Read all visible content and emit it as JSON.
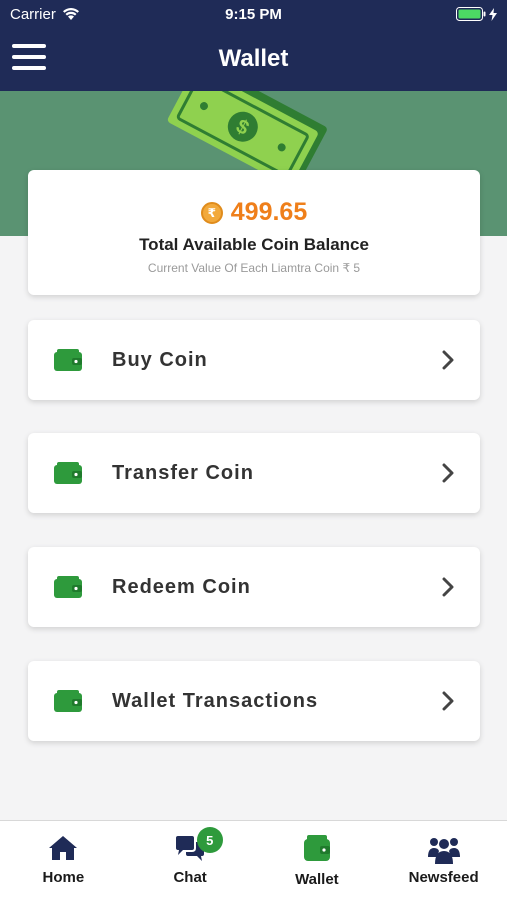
{
  "status_bar": {
    "carrier": "Carrier",
    "time": "9:15 PM"
  },
  "header": {
    "title": "Wallet"
  },
  "colors": {
    "nav": "#1f2b57",
    "banner": "#5a9372",
    "accent": "#ef7f1a",
    "icon_green": "#2e9a3c"
  },
  "balance": {
    "currency_symbol": "₹",
    "amount": "499.65",
    "label": "Total Available Coin Balance",
    "sub": "Current Value Of Each Liamtra Coin ₹ 5"
  },
  "menu": [
    {
      "label": "Buy Coin",
      "icon": "wallet-icon"
    },
    {
      "label": "Transfer Coin",
      "icon": "wallet-icon"
    },
    {
      "label": "Redeem Coin",
      "icon": "wallet-icon"
    },
    {
      "label": "Wallet Transactions",
      "icon": "wallet-icon"
    }
  ],
  "tabs": [
    {
      "label": "Home",
      "icon": "home-icon"
    },
    {
      "label": "Chat",
      "icon": "chat-icon",
      "badge": "5"
    },
    {
      "label": "Wallet",
      "icon": "wallet-icon"
    },
    {
      "label": "Newsfeed",
      "icon": "people-icon"
    }
  ]
}
